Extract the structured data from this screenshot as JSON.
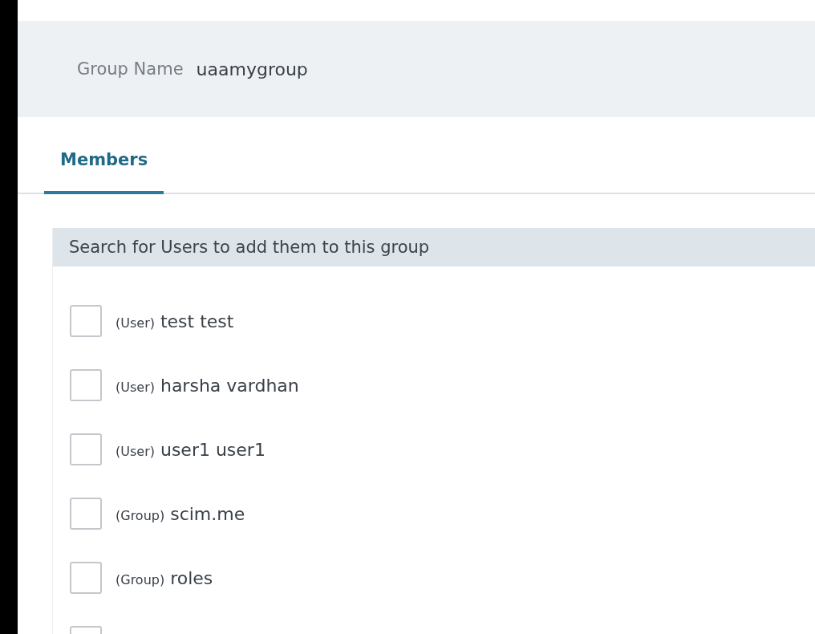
{
  "group": {
    "label": "Group Name",
    "value": "uaamygroup"
  },
  "tabs": [
    {
      "label": "Members",
      "selected": true
    }
  ],
  "search": {
    "placeholder": "Search for Users to add them to this group"
  },
  "members": [
    {
      "type": "(User)",
      "name": "test test",
      "checked": false
    },
    {
      "type": "(User)",
      "name": "harsha vardhan",
      "checked": false
    },
    {
      "type": "(User)",
      "name": "user1 user1",
      "checked": false
    },
    {
      "type": "(Group)",
      "name": "scim.me",
      "checked": false
    },
    {
      "type": "(Group)",
      "name": "roles",
      "checked": false
    },
    {
      "checked": false
    }
  ]
}
